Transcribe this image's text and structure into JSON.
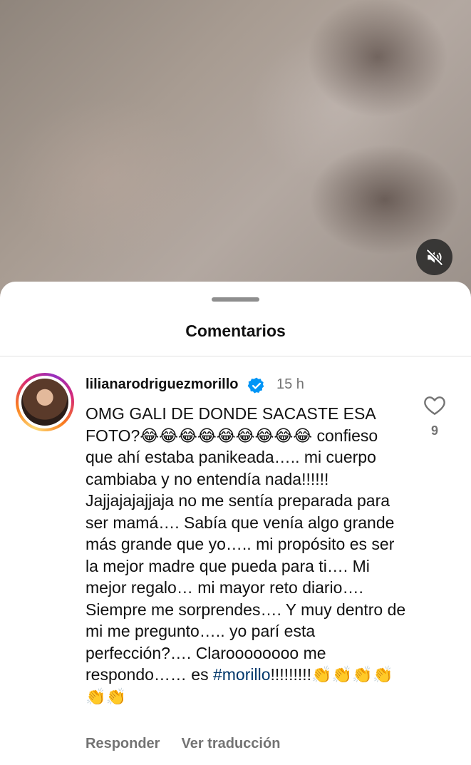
{
  "sheet": {
    "title": "Comentarios"
  },
  "comment": {
    "username": "lilianarodriguezmorillo",
    "time": "15 h",
    "text_before_hashtag": "OMG GALI DE DONDE SACASTE ESA FOTO?😂😂😂😂😂😂😂😂😂 confieso que ahí estaba panikeada….. mi cuerpo cambiaba y no entendía nada!!!!!! Jajjajajajjaja no me sentía preparada para ser mamá…. Sabía que venía algo grande más grande que yo….. mi propósito es ser la mejor madre que pueda para ti…. Mi mejor regalo… mi mayor reto diario…. Siempre me sorprendes…. Y muy dentro de mi me pregunto….. yo parí esta perfección?…. Claroooooooo me respondo…… es ",
    "hashtag": "#morillo",
    "text_after_hashtag": "!!!!!!!!!👏👏👏👏👏👏",
    "like_count": "9",
    "reply_label": "Responder",
    "translate_label": "Ver traducción"
  },
  "icons": {
    "mute": "speaker-muted-icon",
    "verified": "verified-badge-icon",
    "like": "heart-outline-icon"
  },
  "colors": {
    "hashtag": "#00376b",
    "verified": "#0095f6",
    "secondary_text": "#737373"
  }
}
